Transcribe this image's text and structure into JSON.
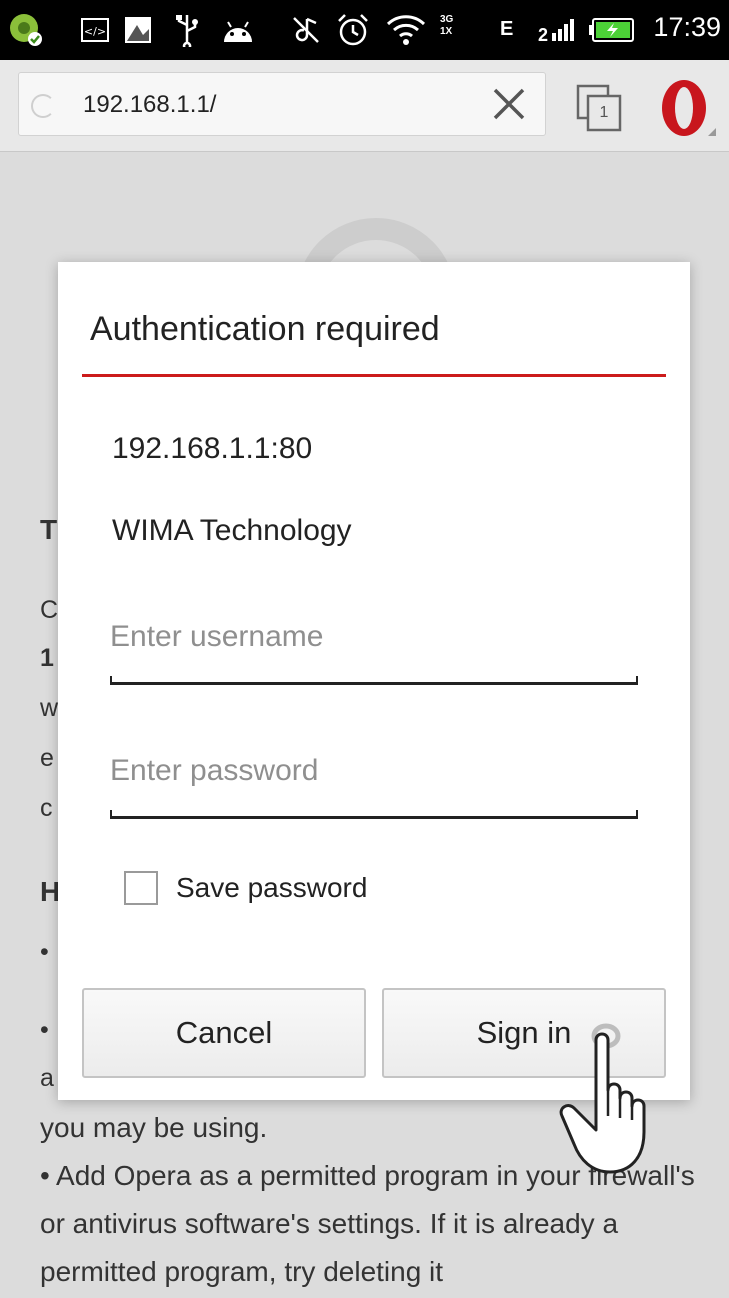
{
  "status_bar": {
    "clock": "17:39",
    "network_type": "E",
    "mobile_data_labels": [
      "3G",
      "1X"
    ],
    "icons": [
      "app-notification-icon",
      "code-icon",
      "image-icon",
      "usb-icon",
      "android-icon",
      "muted-icon",
      "alarm-icon",
      "wifi-icon",
      "mobile-data-icon",
      "signal-icon",
      "battery-charging-icon"
    ]
  },
  "browser": {
    "url": "192.168.1.1/",
    "tab_count": "1",
    "icons": [
      "loading-spinner-icon",
      "clear-icon",
      "tabs-icon",
      "opera-menu-icon"
    ]
  },
  "background_page": {
    "fragments": [
      {
        "text": "T",
        "bold": true
      },
      {
        "text": "C",
        "bold": false
      },
      {
        "text": "1",
        "bold": true
      },
      {
        "text": "w",
        "bold": false
      },
      {
        "text": "e",
        "bold": false
      },
      {
        "text": "c",
        "bold": false
      },
      {
        "text": "H",
        "bold": true
      },
      {
        "text": "•",
        "bold": false
      },
      {
        "text": "•",
        "bold": false
      },
      {
        "text": "a",
        "bold": false
      }
    ],
    "line_after_dialog": "you may be using.",
    "paragraph": "•  Add Opera as a permitted program in your firewall's or antivirus software's settings. If it is already a permitted program, try deleting it"
  },
  "dialog": {
    "title": "Authentication required",
    "host": "192.168.1.1:80",
    "realm": "WIMA Technology",
    "username": {
      "value": "",
      "placeholder": "Enter username"
    },
    "password": {
      "value": "",
      "placeholder": "Enter password"
    },
    "save_password_label": "Save password",
    "save_password_checked": false,
    "cancel_label": "Cancel",
    "signin_label": "Sign in",
    "accent_color": "#cc1b1b"
  },
  "overlay": {
    "icon": "pointing-hand-icon"
  }
}
